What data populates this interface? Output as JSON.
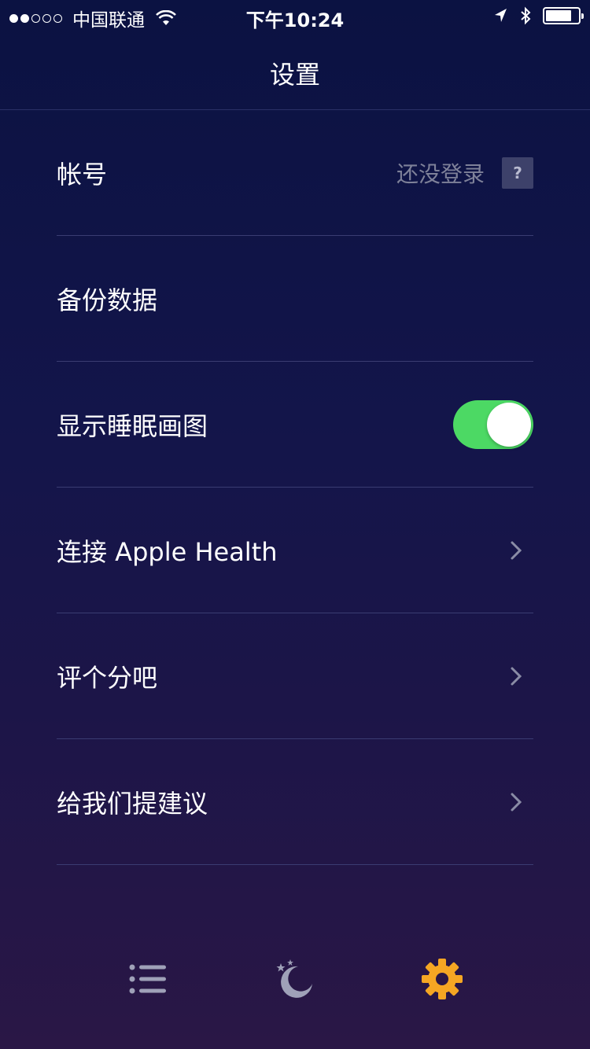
{
  "status_bar": {
    "carrier": "中国联通",
    "time": "下午10:24",
    "signal_strength": 2,
    "signal_max": 5,
    "battery_level": 0.75
  },
  "nav": {
    "title": "设置"
  },
  "settings": {
    "account": {
      "label": "帐号",
      "value": "还没登录",
      "help": "?"
    },
    "backup": {
      "label": "备份数据"
    },
    "sleep_chart": {
      "label": "显示睡眠画图",
      "enabled": true
    },
    "apple_health": {
      "label": "连接 Apple Health"
    },
    "rate": {
      "label": "评个分吧"
    },
    "feedback": {
      "label": "给我们提建议"
    }
  },
  "colors": {
    "toggle_on": "#4cd964",
    "active_tab": "#f5a623",
    "inactive_tab": "#9fa1b8",
    "secondary_text": "#7e8199"
  },
  "tabs": [
    {
      "icon": "list-icon",
      "active": false
    },
    {
      "icon": "moon-stars-icon",
      "active": false
    },
    {
      "icon": "gear-icon",
      "active": true
    }
  ]
}
